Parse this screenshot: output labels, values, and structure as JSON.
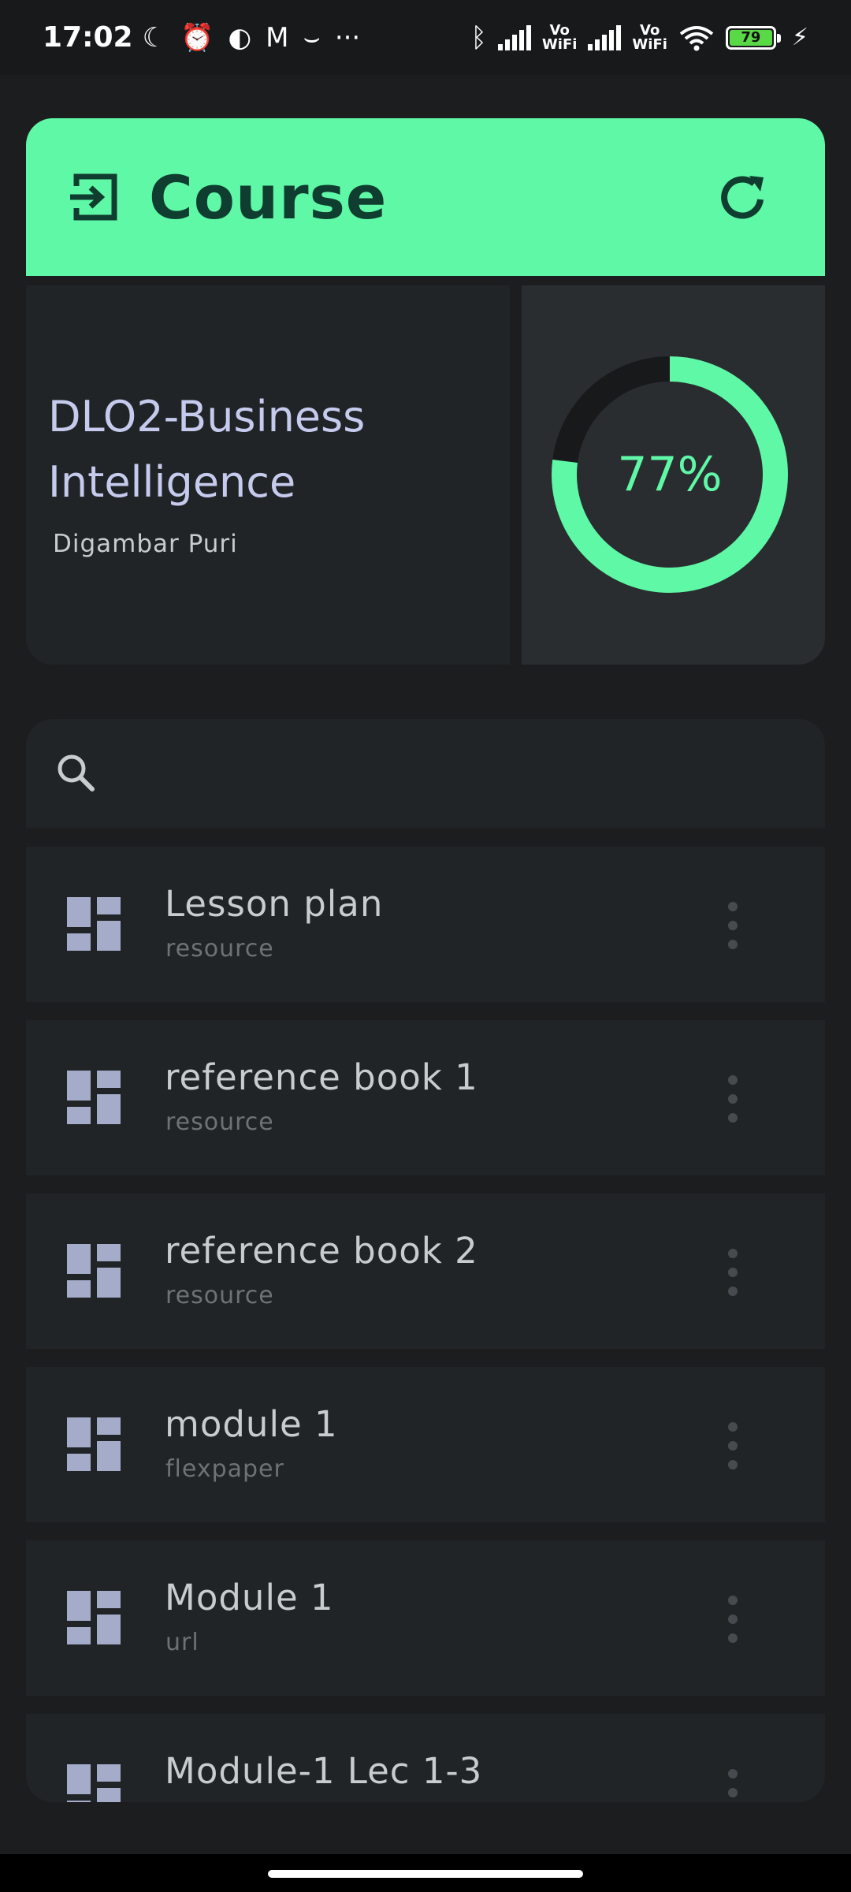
{
  "status_bar": {
    "time": "17:02",
    "battery": "79"
  },
  "header": {
    "title": "Course",
    "accent_color": "#5ff8a6"
  },
  "course": {
    "name": "DLO2-Business Intelligence",
    "teacher": "Digambar Puri",
    "progress_percent": 77,
    "progress_label": "77%"
  },
  "search": {
    "placeholder": "",
    "value": ""
  },
  "items": [
    {
      "title": "Lesson plan",
      "type": "resource"
    },
    {
      "title": "reference book 1",
      "type": "resource"
    },
    {
      "title": "reference book 2",
      "type": "resource"
    },
    {
      "title": "module 1",
      "type": "flexpaper"
    },
    {
      "title": "Module 1",
      "type": "url"
    },
    {
      "title": "Module-1 Lec 1-3",
      "type": ""
    }
  ]
}
